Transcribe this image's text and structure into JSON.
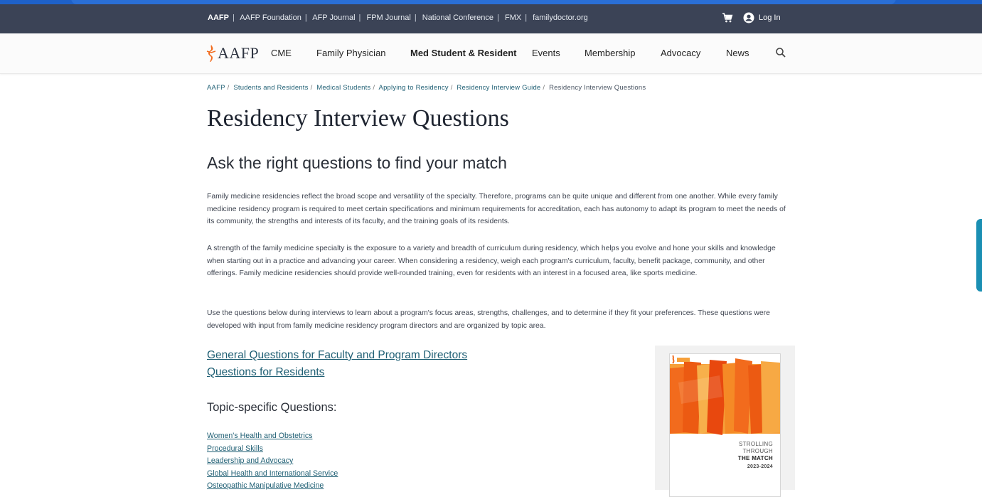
{
  "utility_bar": {
    "links": [
      "AAFP",
      "AAFP Foundation",
      "AFP Journal",
      "FPM Journal",
      "National Conference",
      "FMX",
      "familydoctor.org"
    ],
    "login_label": "Log In"
  },
  "main_nav": {
    "logo_text": "AAFP",
    "items": [
      {
        "label": "CME",
        "active": false
      },
      {
        "label": "Family Physician",
        "active": false
      },
      {
        "label": "Med Student & Resident",
        "active": true
      },
      {
        "label": "Events",
        "active": false
      },
      {
        "label": "Membership",
        "active": false
      },
      {
        "label": "Advocacy",
        "active": false
      },
      {
        "label": "News",
        "active": false
      }
    ]
  },
  "breadcrumb": [
    "AAFP",
    "Students and Residents",
    "Medical Students",
    "Applying to Residency",
    "Residency Interview Guide",
    "Residency Interview Questions"
  ],
  "page": {
    "title": "Residency Interview Questions",
    "subtitle": "Ask the right questions to find your match",
    "paragraphs": [
      "Family medicine residencies reflect the broad scope and versatility of the specialty. Therefore, programs can be quite unique and different from one another. While every family medicine residency program is required to meet certain specifications and minimum requirements for accreditation, each has autonomy to adapt its program to meet the needs of its community, the strengths and interests of its faculty, and the training goals of its residents.",
      "A strength of the family medicine specialty is the exposure to a variety and breadth of curriculum during residency, which helps you evolve and hone your skills and knowledge when starting out in a practice and advancing your career. When considering a residency, weigh each program's curriculum, faculty, benefit package, community, and other offerings. Family medicine residencies should provide well-rounded training, even for residents with an interest in a focused area, like sports medicine.",
      "Use the questions below during interviews to learn about a program's focus areas, strengths, challenges, and to determine if they fit your preferences. These questions were developed with input from family medicine residency program directors and are organized by topic area."
    ],
    "primary_links": [
      "General Questions for Faculty and Program Directors",
      "Questions for Residents"
    ],
    "topic_heading": "Topic-specific Questions:",
    "topic_links": [
      "Women's Health and Obstetrics",
      "Procedural Skills",
      "Leadership and Advocacy",
      "Global Health and International Service",
      "Osteopathic Manipulative Medicine"
    ]
  },
  "promo": {
    "cover_lines": [
      "STROLLING",
      "THROUGH",
      "THE MATCH",
      "2023-2024"
    ]
  },
  "colors": {
    "utility_bg": "#3b4356",
    "link": "#1f5f74",
    "brand_orange": "#f26b1d",
    "side_tab": "#1a8fb3"
  },
  "icons": [
    "cart-icon",
    "user-circle-icon",
    "search-icon",
    "aafp-logo-icon"
  ]
}
